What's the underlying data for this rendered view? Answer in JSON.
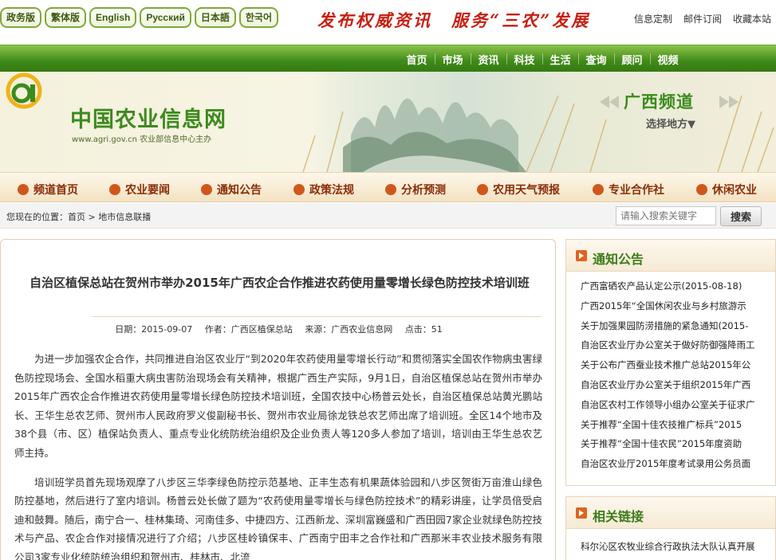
{
  "languages": [
    "政务版",
    "繁体版",
    "English",
    "Русский",
    "日本語",
    "한국어"
  ],
  "slogan": "发布权威资讯　服务“三农”发展",
  "top_links": [
    "信息定制",
    "邮件订阅",
    "收藏本站"
  ],
  "main_nav": [
    "首页",
    "市场",
    "资讯",
    "科技",
    "生活",
    "查询",
    "顾问",
    "视频"
  ],
  "logo": {
    "title": "中国农业信息网",
    "subtitle": "www.agri.gov.cn 农业部信息中心主办"
  },
  "channel": {
    "name": "广西频道",
    "choose": "选择地方▼"
  },
  "sub_nav": [
    {
      "label": "频道首页",
      "icon": "home-icon"
    },
    {
      "label": "农业要闻",
      "icon": "list-icon"
    },
    {
      "label": "通知公告",
      "icon": "document-icon"
    },
    {
      "label": "政策法规",
      "icon": "scale-icon"
    },
    {
      "label": "分析预测",
      "icon": "pen-icon"
    },
    {
      "label": "农用天气预报",
      "icon": "sun-icon"
    },
    {
      "label": "专业合作社",
      "icon": "heart-icon"
    },
    {
      "label": "休闲农业",
      "icon": "globe-icon"
    }
  ],
  "breadcrumb": {
    "prefix": "您现在的位置：",
    "home": "首页",
    "sep": " > ",
    "current": "地市信息联播"
  },
  "search": {
    "placeholder": "请输入搜索关键字",
    "button": "搜索"
  },
  "colors": {
    "nav_green": "#3f8a18",
    "title_red": "#c81f12",
    "accent_orange": "#e0631f",
    "heading_green": "#3d7c1a"
  },
  "article": {
    "title": "自治区植保总站在贺州市举办2015年广西农企合作推进农药使用量零增长绿色防控技术培训班",
    "date": "日期：2015-09-07",
    "author": "作者：广西区植保总站",
    "source": "来源：广西农业信息网",
    "clicks": "点击：51",
    "paragraphs": [
      "为进一步加强农企合作，共同推进自治区农业厅“到2020年农药使用量零增长行动”和贯彻落实全国农作物病虫害绿色防控现场会、全国水稻重大病虫害防治现场会有关精神，根据广西生产实际，9月1日，自治区植保总站在贺州市举办2015年广西农企合作推进农药使用量零增长绿色防控技术培训班，全国农技中心杨普云处长，自治区植保总站黄光鹏站长、王华生总农艺师、贺州市人民政府罗义俊副秘书长、贺州市农业局徐龙铁总农艺师出席了培训班。全区14个地市及38个县（市、区）植保站负责人、重点专业化统防统治组织及企业负责人等120多人参加了培训，培训由王华生总农艺师主持。",
      "培训班学员首先现场观摩了八步区三华李绿色防控示范基地、正丰生态有机果蔬体验园和八步区贺街万亩淮山绿色防控基地，然后进行了室内培训。杨普云处长做了题为“农药使用量零增长与绿色防控技术”的精彩讲座，让学员倍受启迪和鼓舞。随后，南宁合一、桂林集琦、河南佳多、中捷四方、江西新龙、深圳富巍盛和广西田园7家企业就绿色防控技术与产品、农企合作对接情况进行了介绍；八步区桂岭镇保丰、广西南宁田丰之合作社和广西那米丰农业技术服务有限公司3家专业化统防统治组织和贺州市、桂林市、北流"
    ]
  },
  "notices": {
    "title": "通知公告",
    "items": [
      "广西富硒农产品认定公示(2015-08-18)",
      "广西2015年“全国休闲农业与乡村旅游示",
      "关于加强果园防涝措施的紧急通知(2015-",
      "自治区农业厅办公室关于做好防御强降雨工",
      "关于公布广西蚕业技术推广总站2015年公",
      "自治区农业厅办公室关于组织2015年广西",
      "自治区农村工作领导小组办公室关于征求广",
      "关于推荐“全国十佳农技推广标兵”2015",
      "关于推荐“全国十佳农民”2015年度资助",
      "自治区农业厅2015年度考试录用公务员面"
    ]
  },
  "related": {
    "title": "相关链接",
    "items": [
      "科尔沁区农牧业综合行政执法大队认真开展"
    ]
  }
}
